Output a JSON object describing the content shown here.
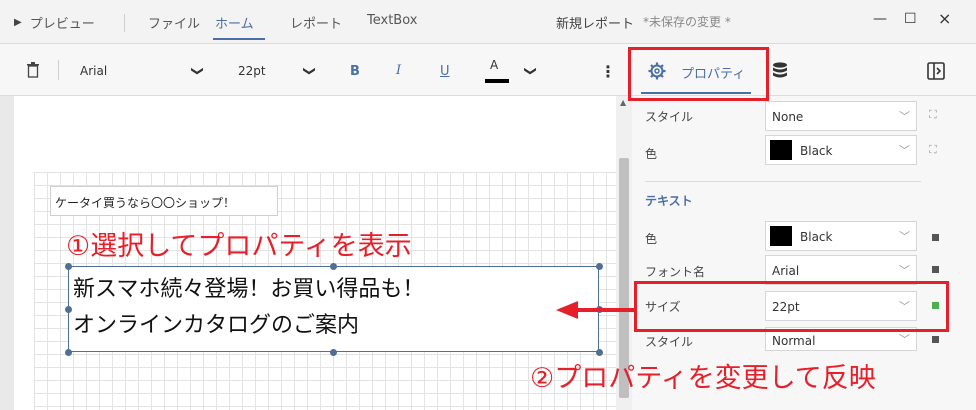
{
  "topbar": {
    "preview": "プレビュー",
    "tabs": [
      "ファイル",
      "ホーム",
      "レポート",
      "TextBox"
    ],
    "document_title": "新規レポート",
    "save_status": "*未保存の変更 *",
    "minimize": "—",
    "maximize": "☐",
    "close": "×"
  },
  "toolbar": {
    "font_name": "Arial",
    "font_size": "22pt",
    "bold": "B",
    "italic": "I",
    "underline": "U",
    "font_color": "A",
    "more": "⋮",
    "icons": {
      "delete": "trash-icon",
      "properties": "gear-icon",
      "data": "database-icon",
      "panel_toggle": "panel-toggle-icon"
    }
  },
  "panel": {
    "properties_tab": "プロパティ",
    "rows": {
      "style_label": "スタイル",
      "style_value": "None",
      "color_label": "色",
      "color_value": "Black",
      "text_section": "テキスト",
      "text_color_label": "色",
      "text_color_value": "Black",
      "font_name_label": "フォント名",
      "font_name_value": "Arial",
      "size_label": "サイズ",
      "size_value": "22pt",
      "text_style_label": "スタイル",
      "text_style_value": "Normal"
    }
  },
  "canvas": {
    "small_text": "ケータイ買うなら〇〇ショップ！",
    "main_line1": "新スマホ続々登場！お買い得品も！",
    "main_line2": "オンラインカタログのご案内"
  },
  "annotations": {
    "step1": "①選択してプロパティを表示",
    "step2": "②プロパティを変更して反映"
  },
  "colors": {
    "accent": "#4a6fa5",
    "annotation_red": "#e6202a",
    "selection": "#4f6f96"
  }
}
